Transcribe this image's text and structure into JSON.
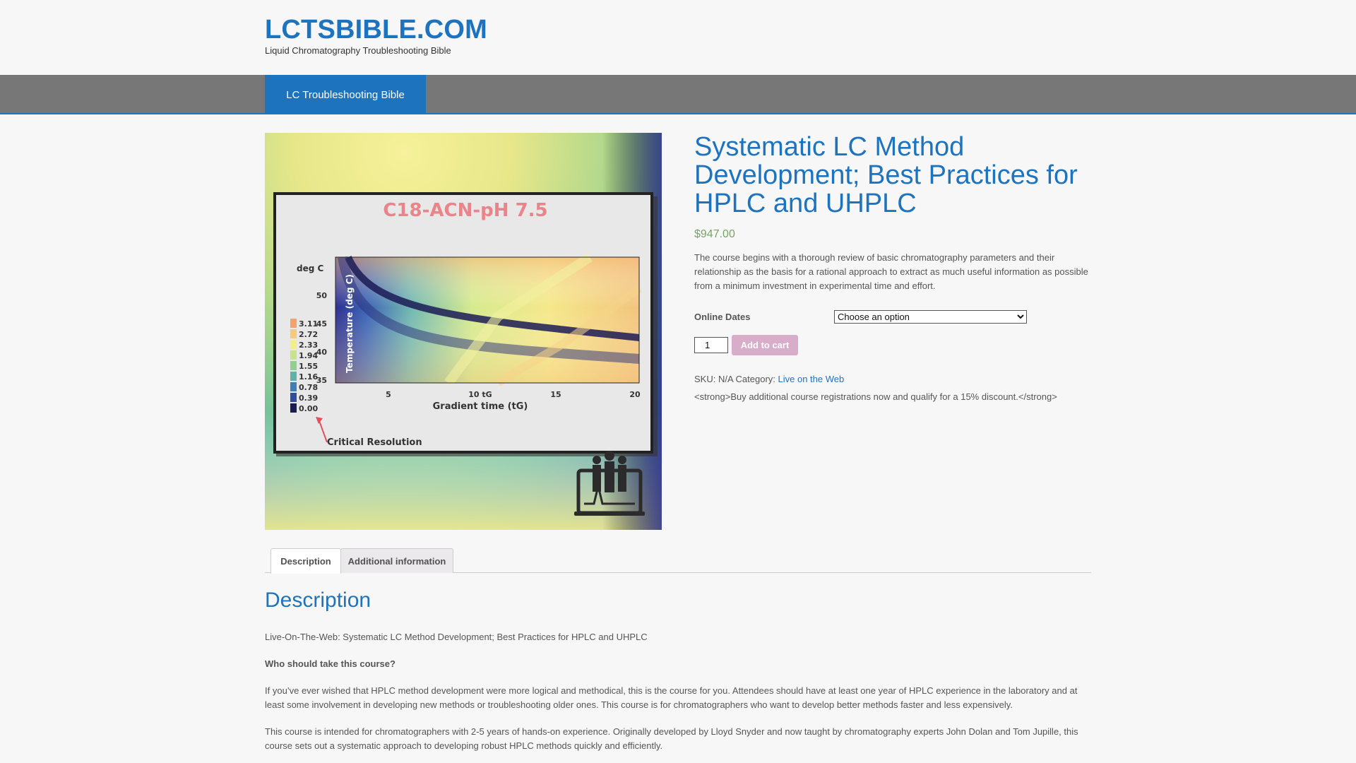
{
  "header": {
    "site_title": "LCTSBIBLE.COM",
    "site_description": "Liquid Chromatography Troubleshooting Bible"
  },
  "nav": {
    "items": [
      {
        "label": "LC Troubleshooting Bible"
      }
    ]
  },
  "product_image": {
    "panel_title": "C18-ACN-pH 7.5",
    "y_axis_unit": "deg C",
    "y_axis_label": "Temperature (deg C)",
    "y_ticks": [
      "50",
      "45",
      "40",
      "35"
    ],
    "x_axis_label": "Gradient time (tG)",
    "x_ticks": [
      "5",
      "10 tG",
      "15",
      "20"
    ],
    "legend": [
      "3.11",
      "2.72",
      "2.33",
      "1.94",
      "1.55",
      "1.16",
      "0.78",
      "0.39",
      "0.00"
    ],
    "legend_colors": [
      "#f2a36b",
      "#f7c97a",
      "#f3ee8c",
      "#c6e58b",
      "#8fcf8f",
      "#5db3a7",
      "#3d7fb9",
      "#2f4f9c",
      "#1b1b55"
    ],
    "annotation": "Critical Resolution"
  },
  "product": {
    "title": "Systematic LC Method Development; Best Practices for HPLC and UHPLC",
    "price": "$947.00",
    "short_description": "The course begins with a thorough review of basic chromatography parameters and their relationship as the basis for a rational approach to extract as much useful information as possible from a minimum investment in experimental time and effort.",
    "variation_label": "Online Dates",
    "variation_selected": "Choose an option",
    "quantity": "1",
    "add_to_cart_label": "Add to cart",
    "sku_text": "SKU: N/A Category: ",
    "category": "Live on the Web",
    "extra_text": "<strong>Buy additional course registrations now and qualify for a 15% discount.</strong>"
  },
  "tabs": {
    "description": "Description",
    "additional_info": "Additional information"
  },
  "description": {
    "heading": "Description",
    "paragraphs": [
      "Live-On-The-Web: Systematic LC Method Development; Best Practices for HPLC and UHPLC",
      "Who should take this course?",
      "If you’ve ever wished that HPLC method development were more logical and methodical, this is the course for you. Attendees should have at least one year of HPLC experience in the laboratory and at least some involvement in developing new methods or troubleshooting older ones. This course is for chromatographers who want to develop better methods faster and less expensively.",
      "This course is intended for chromatographers with 2-5 years of hands-on experience. Originally developed by Lloyd Snyder and now taught by chromatography experts John Dolan and Tom Jupille, this course sets out a systematic approach to developing robust HPLC methods quickly and efficiently."
    ]
  }
}
